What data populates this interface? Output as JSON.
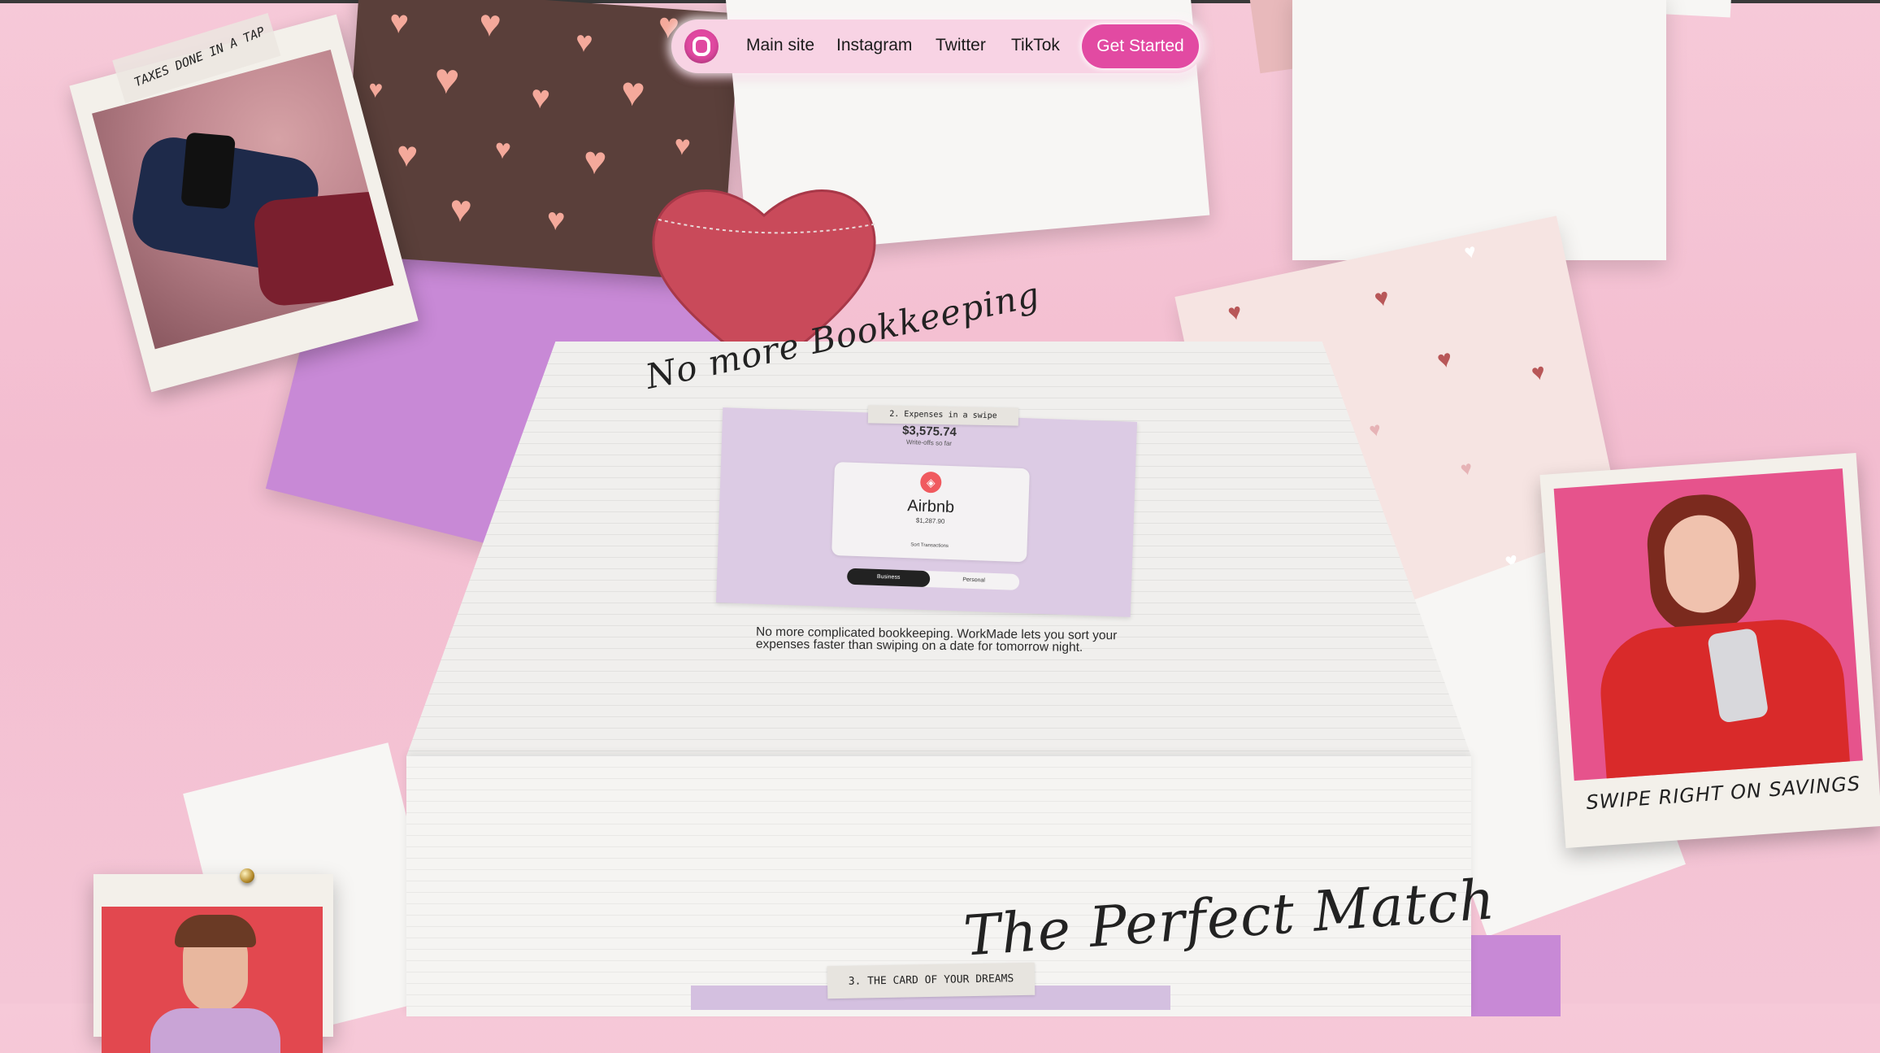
{
  "nav": {
    "logo_icon": "workmade-logo-icon",
    "links": [
      "Main site",
      "Instagram",
      "Twitter",
      "TikTok"
    ],
    "cta_label": "Get Started"
  },
  "collage": {
    "polaroid_left_tape": "TAXES DONE IN A TAP",
    "polaroid_right_caption": "SWIPE RIGHT ON SAVINGS"
  },
  "section": {
    "script_heading": "No more Bookkeeping",
    "label_tape": "2. Expenses in a swipe",
    "app": {
      "total_amount": "$3,575.74",
      "total_label": "Write-offs so far",
      "merchant": "Airbnb",
      "merchant_amount": "$1,287.90",
      "sort_label": "Sort Transactions",
      "toggle_business": "Business",
      "toggle_personal": "Personal"
    },
    "description": "No more complicated bookkeeping. WorkMade lets you sort your expenses faster than swiping on a date for tomorrow night."
  },
  "next_section": {
    "script_heading": "The Perfect Match",
    "label_tape": "3. THE CARD OF YOUR DREAMS"
  },
  "colors": {
    "accent": "#e24aa2",
    "background": "#f6c9d8",
    "airbnb": "#f05a5f"
  }
}
